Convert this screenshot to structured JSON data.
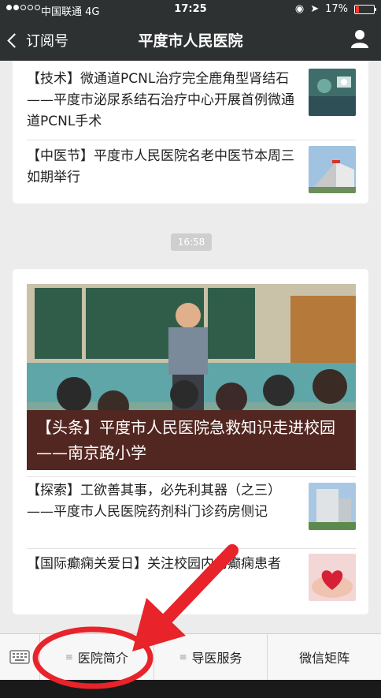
{
  "status": {
    "carrier": "中国联通  4G",
    "time": "17:25",
    "battery": "17%",
    "battery_level": 0.17
  },
  "nav": {
    "back_label": "订阅号",
    "title": "平度市人民医院"
  },
  "articles_top": [
    {
      "text": "【技术】微通道PCNL治疗完全鹿角型肾结石——平度市泌尿系结石治疗中心开展首例微通道PCNL手术",
      "thumb": "surgery-photo"
    },
    {
      "text": "【中医节】平度市人民医院名老中医节本周三如期举行",
      "thumb": "hospital-building-photo"
    }
  ],
  "timestamp": "16:58",
  "headline": {
    "caption": "【头条】平度市人民医院急救知识走进校园——南京路小学",
    "image": "classroom-photo"
  },
  "articles_bottom": [
    {
      "text": "【探索】工欲善其事，必先利其器（之三）——平度市人民医院药剂科门诊药房侧记",
      "thumb": "building-photo"
    },
    {
      "text": "【国际癫痫关爱日】关注校园内的癫痫患者",
      "thumb": "heart-hands-photo"
    }
  ],
  "bottom_menu": {
    "items": [
      "医院简介",
      "导医服务",
      "微信矩阵"
    ]
  },
  "colors": {
    "nav_bg": "#2e3132",
    "annotation": "#e8232a"
  }
}
